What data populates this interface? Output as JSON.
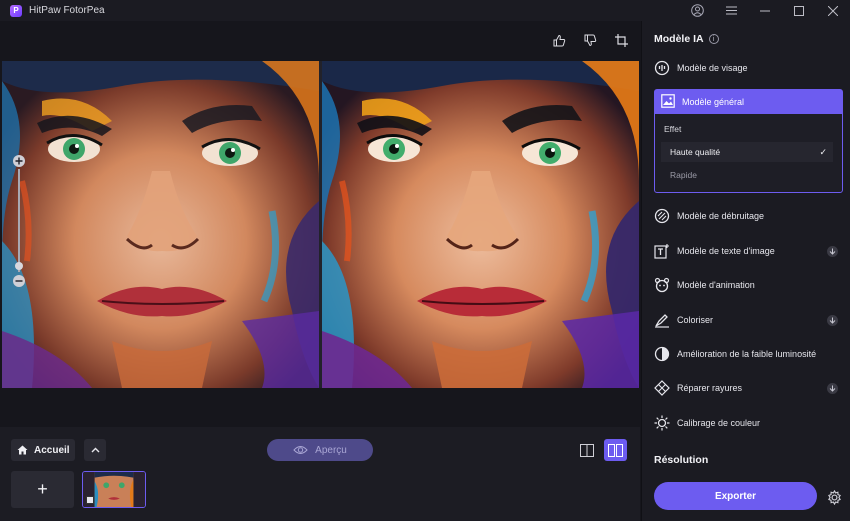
{
  "app": {
    "title": "HitPaw FotorPea",
    "logo_letter": "P"
  },
  "bottom": {
    "home_label": "Accueil",
    "preview_label": "Aperçu",
    "add_label": "+"
  },
  "panel": {
    "title": "Modèle IA",
    "info": "i",
    "models": [
      {
        "label": "Modèle de visage",
        "icon": "face-model-icon"
      },
      {
        "label": "Modèle général",
        "icon": "image-icon"
      },
      {
        "label": "Modèle de débruitage",
        "icon": "denoise-icon"
      },
      {
        "label": "Modèle de texte d'image",
        "icon": "text-image-icon"
      },
      {
        "label": "Modèle d'animation",
        "icon": "animation-icon"
      },
      {
        "label": "Coloriser",
        "icon": "colorize-icon"
      },
      {
        "label": "Amélioration de la faible luminosité",
        "icon": "low-light-icon"
      },
      {
        "label": "Réparer rayures",
        "icon": "scratch-repair-icon"
      },
      {
        "label": "Calibrage de couleur",
        "icon": "color-calibration-icon"
      }
    ],
    "effect": {
      "label": "Effet",
      "options": [
        {
          "label": "Haute qualité",
          "selected": true
        },
        {
          "label": "Rapide",
          "selected": false
        }
      ],
      "check": "✓"
    },
    "resolution_title": "Résolution",
    "export_label": "Exporter"
  },
  "colors": {
    "accent": "#6d5cf0",
    "background": "#16161c",
    "panel": "#1b1b22"
  }
}
